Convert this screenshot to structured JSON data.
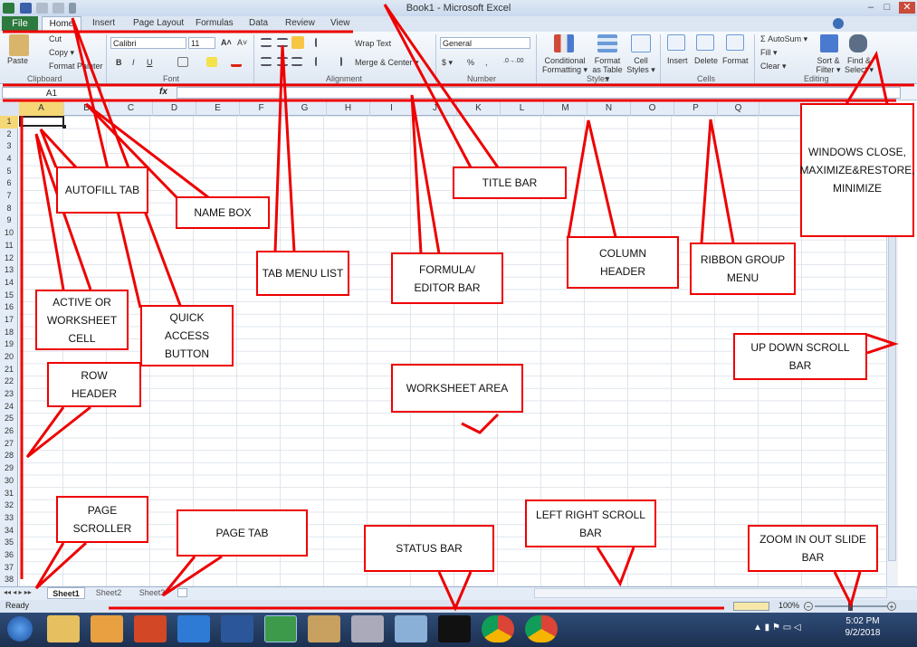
{
  "app": {
    "title": "Book1  -  Microsoft Excel",
    "window_buttons": [
      "–",
      "□",
      "✕"
    ]
  },
  "ribbon": {
    "file_tab": "File",
    "tabs": [
      "Home",
      "Insert",
      "Page Layout",
      "Formulas",
      "Data",
      "Review",
      "View"
    ],
    "clipboard": {
      "paste": "Paste",
      "cut": "Cut",
      "copy": "Copy ▾",
      "format_painter": "Format Painter",
      "label": "Clipboard"
    },
    "font": {
      "name": "Calibri",
      "size": "11",
      "bold": "B",
      "italic": "I",
      "underline": "U",
      "grow": "A˄",
      "shrink": "A˅",
      "label": "Font"
    },
    "alignment": {
      "wrap": "Wrap Text",
      "merge": "Merge & Center ▾",
      "label": "Alignment"
    },
    "number": {
      "format": "General",
      "currency": "$ ▾",
      "percent": "%",
      "comma": ",",
      "inc_dec": ".0→.00",
      "dec_dec": ".00→.0",
      "label": "Number"
    },
    "styles": {
      "conditional": "Conditional Formatting ▾",
      "format_table": "Format as Table ▾",
      "cell_styles": "Cell Styles ▾",
      "label": "Styles"
    },
    "cells": {
      "insert": "Insert",
      "delete": "Delete",
      "format": "Format",
      "label": "Cells"
    },
    "editing": {
      "autosum": "Σ AutoSum ▾",
      "fill": "Fill ▾",
      "clear": "Clear ▾",
      "sort": "Sort & Filter ▾",
      "find": "Find & Select ▾",
      "label": "Editing"
    }
  },
  "formula_bar": {
    "name_box": "A1",
    "fx": "fx",
    "value": ""
  },
  "columns": [
    "A",
    "B",
    "C",
    "D",
    "E",
    "F",
    "G",
    "H",
    "I",
    "J",
    "K",
    "L",
    "M",
    "N",
    "O",
    "P",
    "Q"
  ],
  "rows": [
    "1",
    "2",
    "3",
    "4",
    "5",
    "6",
    "7",
    "8",
    "9",
    "10",
    "11",
    "12",
    "13",
    "14",
    "15",
    "16",
    "17",
    "18",
    "19",
    "20",
    "21",
    "22",
    "23",
    "24",
    "25",
    "26",
    "27",
    "28",
    "29",
    "30",
    "31",
    "32",
    "33",
    "34",
    "35",
    "36",
    "37",
    "38"
  ],
  "sheets": [
    "Sheet1",
    "Sheet2",
    "Sheet3"
  ],
  "status": {
    "ready": "Ready",
    "zoom": "100%"
  },
  "taskbar": {
    "time": "5:02 PM",
    "date": "9/2/2018"
  },
  "callouts": {
    "autofill": "AUTOFILL TAB",
    "name_box": "NAME BOX",
    "title_bar": "TITLE BAR",
    "windows": "WINDOWS CLOSE, MAXIMIZE&RESTORE, MINIMIZE",
    "tab_menu": "TAB MENU LIST",
    "formula": "FORMULA/ EDITOR BAR",
    "column_header": "COLUMN HEADER",
    "ribbon_group": "RIBBON GROUP MENU",
    "active_cell": "ACTIVE OR WORKSHEET CELL",
    "quick_access": "QUICK ACCESS BUTTON",
    "row_header": "ROW HEADER",
    "worksheet_area": "WORKSHEET AREA",
    "updown_scroll": "UP DOWN SCROLL BAR",
    "page_scroller": "PAGE SCROLLER",
    "page_tab": "PAGE TAB",
    "status_bar": "STATUS BAR",
    "leftright_scroll": "LEFT RIGHT SCROLL BAR",
    "zoom": "ZOOM IN OUT SLIDE BAR"
  },
  "colors": {
    "accent_red": "#e00000",
    "file_tab": "#2c7a3d",
    "ribbon": "#dfe8f3"
  }
}
